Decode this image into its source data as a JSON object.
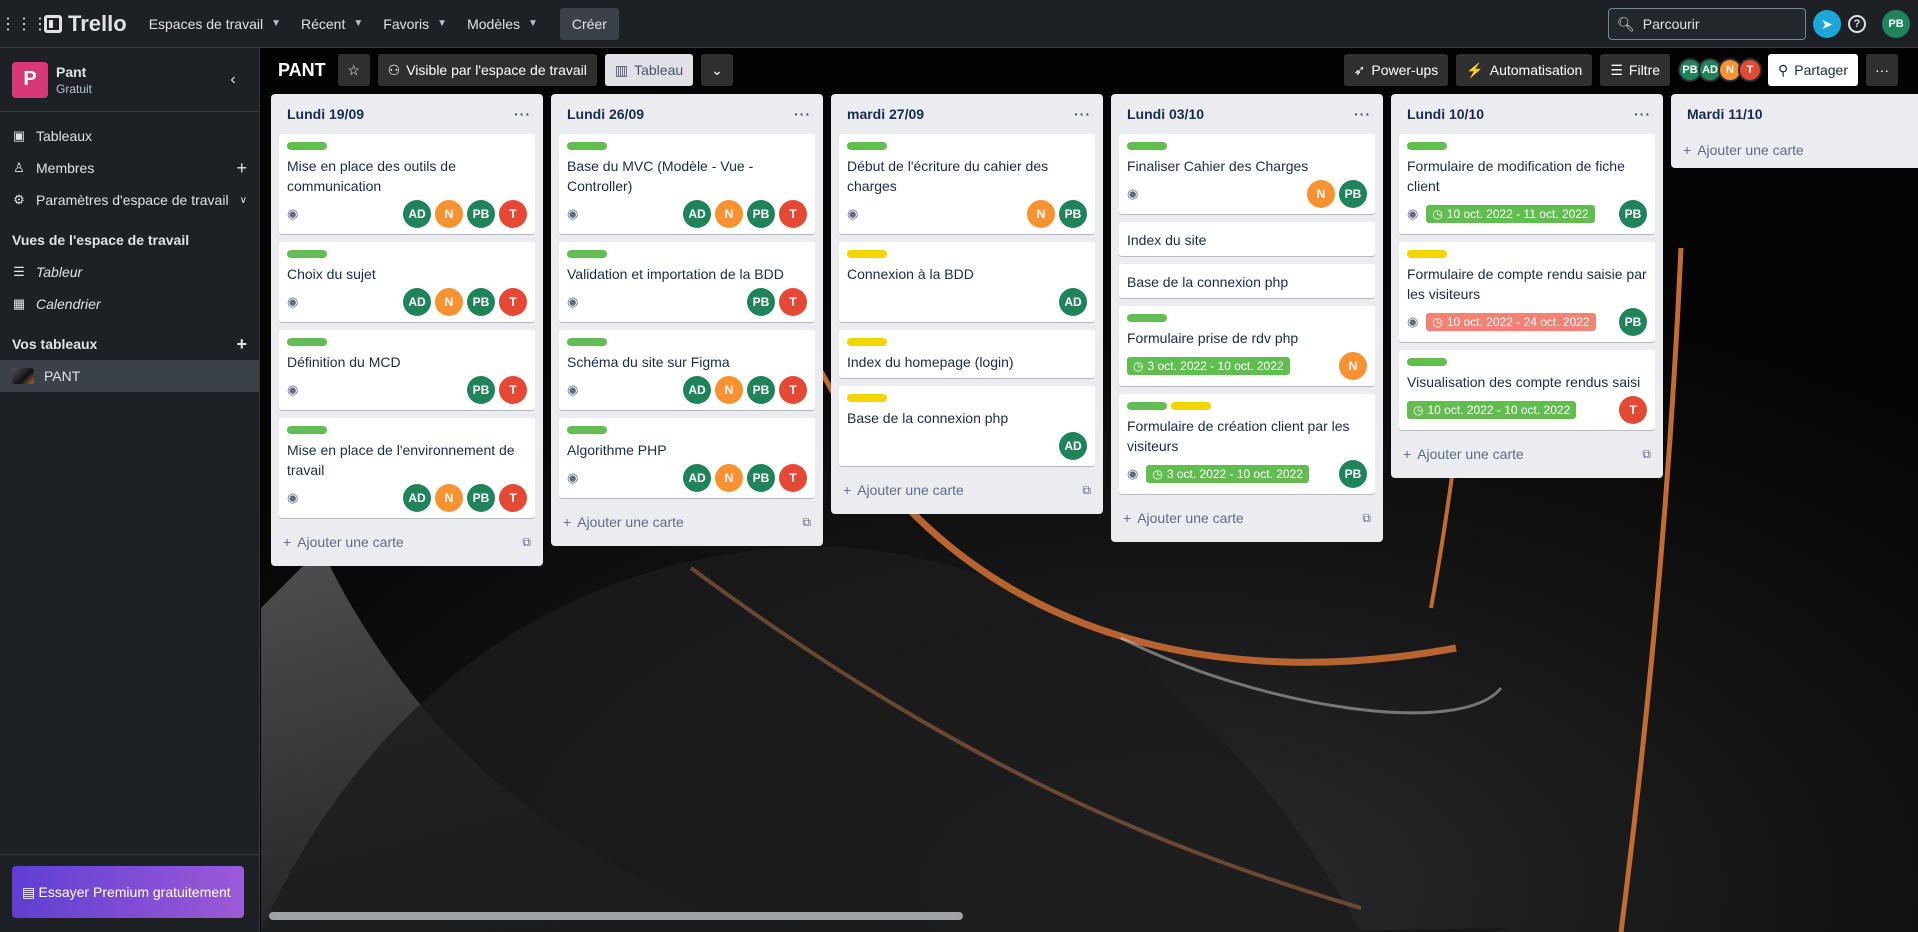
{
  "topnav": {
    "logo": "Trello",
    "menus": [
      "Espaces de travail",
      "Récent",
      "Favoris",
      "Modèles"
    ],
    "create": "Créer",
    "search_placeholder": "Parcourir",
    "user_initials": "PB"
  },
  "sidebar": {
    "workspace_initial": "P",
    "workspace_name": "Pant",
    "workspace_plan": "Gratuit",
    "items": [
      "Tableaux",
      "Membres",
      "Paramètres d'espace de travail"
    ],
    "views_title": "Vues de l'espace de travail",
    "views": [
      "Tableur",
      "Calendrier"
    ],
    "boards_title": "Vos tableaux",
    "boards": [
      "PANT"
    ],
    "premium": "Essayer Premium gratuitement"
  },
  "board": {
    "title": "PANT",
    "visibility": "Visible par l'espace de travail",
    "view": "Tableau",
    "powerups": "Power-ups",
    "automation": "Automatisation",
    "filter": "Filtre",
    "members": [
      "PB",
      "AD",
      "N",
      "T"
    ],
    "share": "Partager",
    "add_card": "Ajouter une carte"
  },
  "lists": [
    {
      "title": "Lundi 19/09",
      "cards": [
        {
          "labels": [
            "green"
          ],
          "title": "Mise en place des outils de communication",
          "watch": true,
          "members": [
            "AD",
            "N",
            "PB",
            "T"
          ]
        },
        {
          "labels": [
            "green"
          ],
          "title": "Choix du sujet",
          "watch": true,
          "members": [
            "AD",
            "N",
            "PB",
            "T"
          ]
        },
        {
          "labels": [
            "green"
          ],
          "title": "Définition du MCD",
          "watch": true,
          "members": [
            "PB",
            "T"
          ]
        },
        {
          "labels": [
            "green"
          ],
          "title": "Mise en place de l'environnement de travail",
          "watch": true,
          "members": [
            "AD",
            "N",
            "PB",
            "T"
          ]
        }
      ]
    },
    {
      "title": "Lundi 26/09",
      "cards": [
        {
          "labels": [
            "green"
          ],
          "title": "Base du MVC (Modèle - Vue - Controller)",
          "watch": true,
          "members": [
            "AD",
            "N",
            "PB",
            "T"
          ]
        },
        {
          "labels": [
            "green"
          ],
          "title": "Validation et importation de la BDD",
          "watch": true,
          "members": [
            "PB",
            "T"
          ]
        },
        {
          "labels": [
            "green"
          ],
          "title": "Schéma du site sur Figma",
          "watch": true,
          "members": [
            "AD",
            "N",
            "PB",
            "T"
          ]
        },
        {
          "labels": [
            "green"
          ],
          "title": "Algorithme PHP",
          "watch": true,
          "members": [
            "AD",
            "N",
            "PB",
            "T"
          ]
        }
      ]
    },
    {
      "title": "mardi 27/09",
      "cards": [
        {
          "labels": [
            "green"
          ],
          "title": "Début de l'écriture du cahier des charges",
          "watch": true,
          "members": [
            "N",
            "PB"
          ]
        },
        {
          "labels": [
            "yellow"
          ],
          "title": "Connexion à la BDD",
          "watch": false,
          "members": [
            "AD"
          ]
        },
        {
          "labels": [
            "yellow"
          ],
          "title": "Index du homepage (login)",
          "watch": false,
          "members": []
        },
        {
          "labels": [
            "yellow"
          ],
          "title": "Base de la connexion php",
          "watch": false,
          "members": [
            "AD"
          ]
        }
      ]
    },
    {
      "title": "Lundi 03/10",
      "cards": [
        {
          "labels": [
            "green"
          ],
          "title": "Finaliser Cahier des Charges",
          "watch": true,
          "members": [
            "N",
            "PB"
          ]
        },
        {
          "labels": [],
          "title": "Index du site",
          "watch": false,
          "members": []
        },
        {
          "labels": [],
          "title": "Base de la connexion php",
          "watch": false,
          "members": []
        },
        {
          "labels": [
            "green"
          ],
          "title": "Formulaire prise de rdv php",
          "watch": false,
          "due": "3 oct. 2022 - 10 oct. 2022",
          "due_color": "green",
          "members": [
            "N"
          ]
        },
        {
          "labels": [
            "green",
            "yellow"
          ],
          "title": "Formulaire de création client par les visiteurs",
          "watch": true,
          "due": "3 oct. 2022 - 10 oct. 2022",
          "due_color": "green",
          "members": [
            "PB"
          ]
        }
      ]
    },
    {
      "title": "Lundi 10/10",
      "cards": [
        {
          "labels": [
            "green"
          ],
          "title": "Formulaire de modification de fiche client",
          "watch": true,
          "due": "10 oct. 2022 - 11 oct. 2022",
          "due_color": "green",
          "members": [
            "PB"
          ]
        },
        {
          "labels": [
            "yellow"
          ],
          "title": "Formulaire de compte rendu saisie par les visiteurs",
          "watch": true,
          "due": "10 oct. 2022 - 24 oct. 2022",
          "due_color": "red",
          "members": [
            "PB"
          ]
        },
        {
          "labels": [
            "green"
          ],
          "title": "Visualisation des compte rendus saisi",
          "watch": false,
          "due": "10 oct. 2022 - 10 oct. 2022",
          "due_color": "green",
          "members": [
            "T"
          ]
        }
      ]
    },
    {
      "title": "Mardi 11/10",
      "cards": []
    }
  ],
  "colors": {
    "label_green": "#61bd4f",
    "label_yellow": "#f2d600",
    "member_AD": "#1f845a",
    "member_N": "#f79233",
    "member_PB": "#1f845a",
    "member_T": "#e34935"
  }
}
